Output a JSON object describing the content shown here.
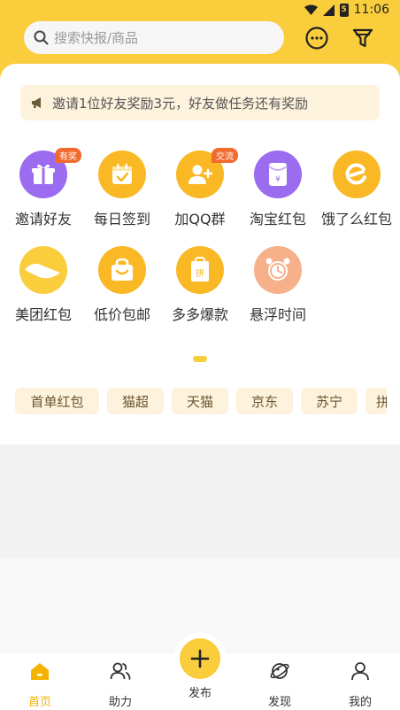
{
  "status": {
    "time": "11:06",
    "battery_level": "5"
  },
  "header": {
    "search_placeholder": "搜索快报/商品"
  },
  "notice": {
    "text": "邀请1位好友奖励3元，好友做任务还有奖励"
  },
  "grid": [
    {
      "label": "邀请好友",
      "icon": "gift-icon",
      "badge": "有奖",
      "color": "#9b6cf0"
    },
    {
      "label": "每日签到",
      "icon": "calendar-check-icon",
      "badge": "",
      "color": "#f9b824"
    },
    {
      "label": "加QQ群",
      "icon": "add-user-icon",
      "badge": "交流",
      "color": "#f9b824"
    },
    {
      "label": "淘宝红包",
      "icon": "red-envelope-icon",
      "badge": "",
      "color": "#9b6cf0"
    },
    {
      "label": "饿了么红包",
      "icon": "eleme-icon",
      "badge": "",
      "color": "#f9b824"
    },
    {
      "label": "美团红包",
      "icon": "meituan-icon",
      "badge": "",
      "color": "#f9cd3c"
    },
    {
      "label": "低价包邮",
      "icon": "shopping-bag-icon",
      "badge": "",
      "color": "#f9b824"
    },
    {
      "label": "多多爆款",
      "icon": "pinduoduo-icon",
      "badge": "",
      "color": "#f9b824"
    },
    {
      "label": "悬浮时间",
      "icon": "alarm-clock-icon",
      "badge": "",
      "color": "#f6b08a"
    }
  ],
  "chips": [
    "首单红包",
    "猫超",
    "天猫",
    "京东",
    "苏宁",
    "拼"
  ],
  "tabs": [
    {
      "label": "首页",
      "icon": "home-icon",
      "active": true
    },
    {
      "label": "助力",
      "icon": "users-icon",
      "active": false
    },
    {
      "label": "发布",
      "icon": "plus-icon",
      "active": false
    },
    {
      "label": "发现",
      "icon": "planet-icon",
      "active": false
    },
    {
      "label": "我的",
      "icon": "profile-icon",
      "active": false
    }
  ],
  "colors": {
    "accent": "#f9cd3c",
    "active_tab": "#f4b300",
    "badge": "#f26a2e"
  }
}
